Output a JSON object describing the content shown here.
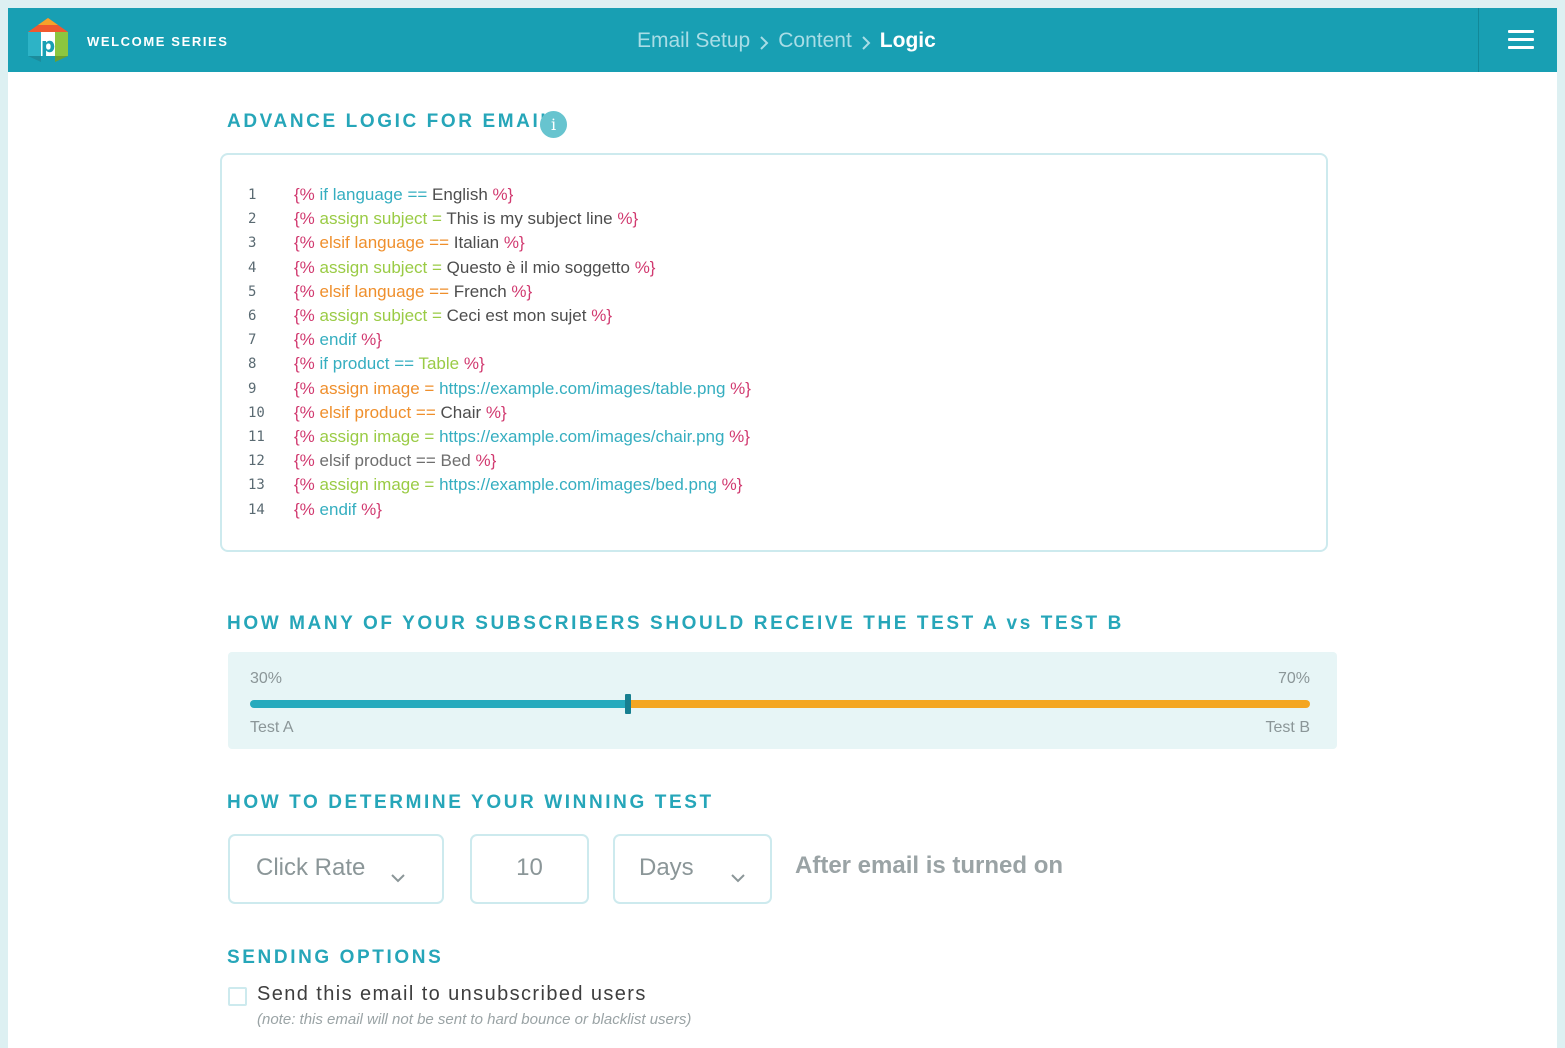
{
  "header": {
    "series_title": "WELCOME SERIES",
    "breadcrumb": [
      "Email Setup",
      "Content",
      "Logic"
    ],
    "icons": {
      "logo": "brand-logo",
      "menu": "hamburger-menu-icon"
    },
    "colors": {
      "bar": "#189fb3"
    }
  },
  "logic": {
    "title": "ADVANCE LOGIC FOR EMAIL",
    "info_icon_glyph": "i",
    "lines": [
      {
        "n": "1",
        "parts": [
          [
            "delim",
            "{% "
          ],
          [
            "teal",
            "if language "
          ],
          [
            "op-teal",
            "== "
          ],
          [
            "lit",
            "English "
          ],
          [
            "delim",
            "%}"
          ]
        ]
      },
      {
        "n": "2",
        "parts": [
          [
            "delim",
            "{% "
          ],
          [
            "green",
            "assign subject "
          ],
          [
            "op-green",
            "= "
          ],
          [
            "lit",
            "This is my subject line "
          ],
          [
            "delim",
            "%}"
          ]
        ]
      },
      {
        "n": "3",
        "parts": [
          [
            "delim",
            "{% "
          ],
          [
            "orange",
            "elsif language "
          ],
          [
            "op-orange",
            "== "
          ],
          [
            "lit",
            "Italian "
          ],
          [
            "delim",
            "%}"
          ]
        ]
      },
      {
        "n": "4",
        "parts": [
          [
            "delim",
            "{% "
          ],
          [
            "green",
            "assign subject "
          ],
          [
            "op-green",
            "= "
          ],
          [
            "lit",
            "Questo è il mio soggetto "
          ],
          [
            "delim",
            "%}"
          ]
        ]
      },
      {
        "n": "5",
        "parts": [
          [
            "delim",
            "{% "
          ],
          [
            "orange",
            "elsif language "
          ],
          [
            "op-orange",
            "== "
          ],
          [
            "lit",
            "French "
          ],
          [
            "delim",
            "%}"
          ]
        ]
      },
      {
        "n": "6",
        "parts": [
          [
            "delim",
            "{% "
          ],
          [
            "green",
            "assign subject "
          ],
          [
            "op-green",
            "= "
          ],
          [
            "lit",
            "Ceci est mon sujet "
          ],
          [
            "delim",
            "%}"
          ]
        ]
      },
      {
        "n": "7",
        "parts": [
          [
            "delim",
            "{% "
          ],
          [
            "teal",
            "endif "
          ],
          [
            "delim",
            "%}"
          ]
        ]
      },
      {
        "n": "8",
        "parts": [
          [
            "delim",
            "{% "
          ],
          [
            "teal",
            "if product "
          ],
          [
            "op-teal",
            "== "
          ],
          [
            "green",
            "Table "
          ],
          [
            "delim",
            "%}"
          ]
        ]
      },
      {
        "n": "9",
        "parts": [
          [
            "delim",
            "{% "
          ],
          [
            "orange",
            "assign image "
          ],
          [
            "op-orange",
            "= "
          ],
          [
            "url",
            "https://example.com/images/table.png "
          ],
          [
            "delim",
            "%}"
          ]
        ]
      },
      {
        "n": "10",
        "parts": [
          [
            "delim",
            "{% "
          ],
          [
            "orange",
            "elsif product "
          ],
          [
            "op-orange",
            "== "
          ],
          [
            "lit",
            "Chair "
          ],
          [
            "delim",
            "%}"
          ]
        ]
      },
      {
        "n": "11",
        "parts": [
          [
            "delim",
            "{% "
          ],
          [
            "green",
            "assign image "
          ],
          [
            "op-green",
            "= "
          ],
          [
            "url",
            "https://example.com/images/chair.png "
          ],
          [
            "delim",
            "%}"
          ]
        ]
      },
      {
        "n": "12",
        "parts": [
          [
            "delim",
            "{% "
          ],
          [
            "gray",
            "elsif product == Bed "
          ],
          [
            "delim",
            "%}"
          ]
        ]
      },
      {
        "n": "13",
        "parts": [
          [
            "delim",
            "{% "
          ],
          [
            "green",
            "assign image "
          ],
          [
            "op-green",
            "= "
          ],
          [
            "url",
            "https://example.com/images/bed.png "
          ],
          [
            "delim",
            "%}"
          ]
        ]
      },
      {
        "n": "14",
        "parts": [
          [
            "delim",
            "{% "
          ],
          [
            "teal",
            "endif "
          ],
          [
            "delim",
            "%}"
          ]
        ]
      }
    ]
  },
  "split": {
    "title": "HOW MANY OF YOUR SUBSCRIBERS SHOULD RECEIVE THE TEST A vs TEST B",
    "left_pct": "30%",
    "right_pct": "70%",
    "left_label": "Test A",
    "right_label": "Test B",
    "slider_value": 0.3,
    "colors": {
      "a": "#26aabd",
      "b": "#f4a621"
    }
  },
  "winning": {
    "title": "HOW TO DETERMINE YOUR WINNING TEST",
    "metric_value": "Click Rate",
    "duration_value": "10",
    "unit_value": "Days",
    "after_text": "After email is turned on"
  },
  "sending": {
    "title": "SENDING OPTIONS",
    "checkbox_label": "Send this email to unsubscribed users",
    "checked": false,
    "note": "(note: this email will not be sent to hard bounce or blacklist users)"
  }
}
